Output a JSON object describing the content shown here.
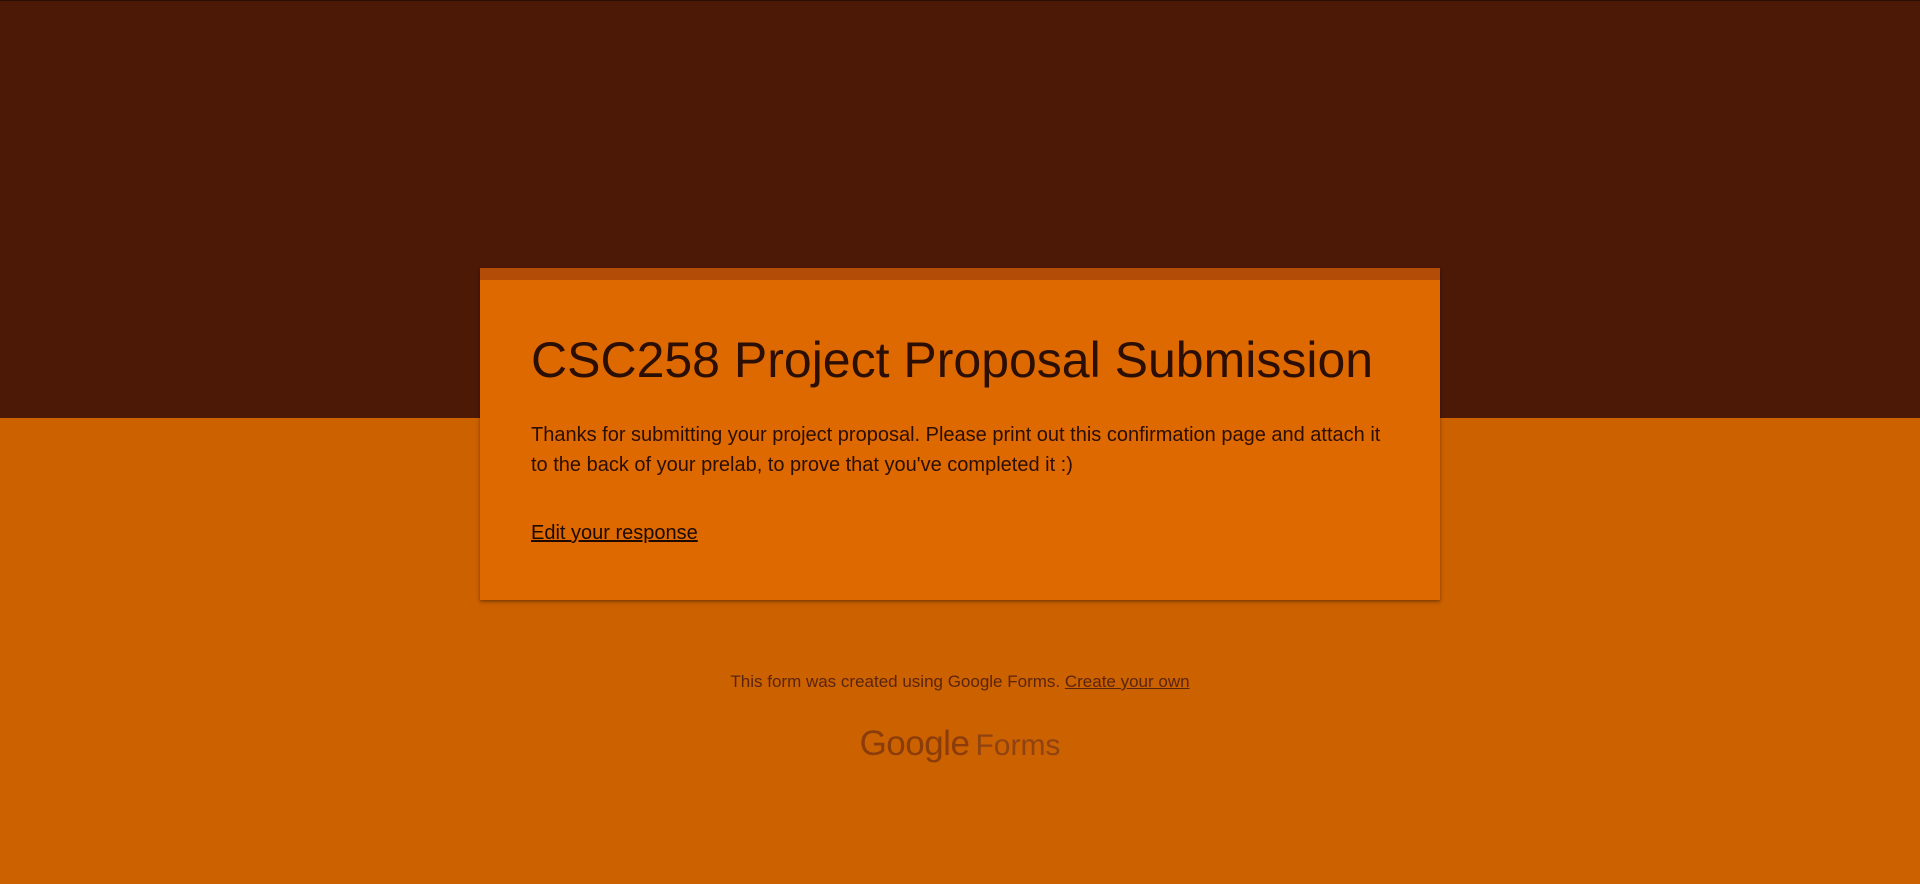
{
  "colors": {
    "page_background": "#cc6100",
    "header_band": "#4c1907",
    "card_background": "#de6900",
    "card_accent": "#b34c06",
    "text_dark": "#2b0e04"
  },
  "form": {
    "title": "CSC258 Project Proposal Submission",
    "confirmation_message": "Thanks for submitting your project proposal. Please print out this confirmation page and attach it to the back of your prelab, to prove that you've completed it :)",
    "edit_link_label": "Edit your response"
  },
  "footer": {
    "note_text": "This form was created using Google Forms.",
    "create_link_label": "Create your own",
    "brand_google": "Google",
    "brand_forms": "Forms"
  }
}
